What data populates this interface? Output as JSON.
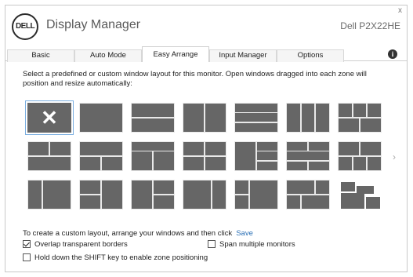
{
  "header": {
    "logo_text": "DELL",
    "title": "Display Manager",
    "model": "Dell P2X22HE",
    "close_icon": "x"
  },
  "tabs": [
    {
      "label": "Basic"
    },
    {
      "label": "Auto Mode"
    },
    {
      "label": "Easy Arrange",
      "active": true
    },
    {
      "label": "Input Manager"
    },
    {
      "label": "Options"
    }
  ],
  "info_icon": "i",
  "instruction": "Select a predefined or custom window layout for this monitor.  Open windows dragged into each zone will position and resize automatically:",
  "layouts": {
    "selected_mark": "✕",
    "selected_index": 0,
    "count": 21,
    "next_icon": "›"
  },
  "custom": {
    "text": "To create a custom layout, arrange your windows and then click",
    "save_label": "Save"
  },
  "options": {
    "overlap": {
      "label": "Overlap transparent borders",
      "checked": true
    },
    "span": {
      "label": "Span multiple monitors",
      "checked": false
    },
    "shift": {
      "label": "Hold down the SHIFT key to enable zone positioning",
      "checked": false
    }
  }
}
